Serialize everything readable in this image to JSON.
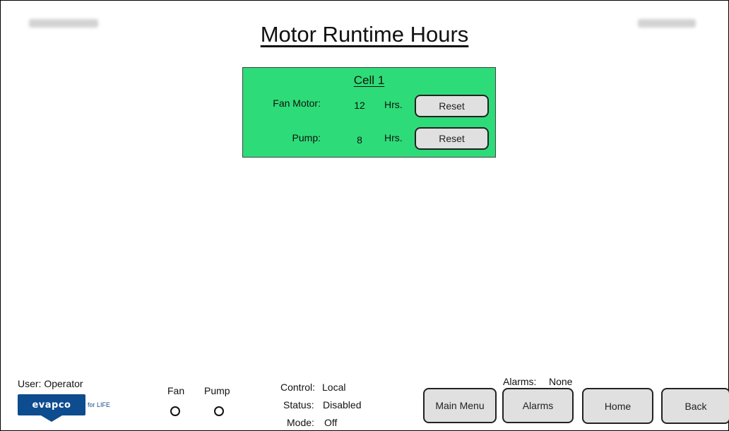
{
  "header": {
    "title": "Motor Runtime Hours"
  },
  "cell": {
    "title": "Cell 1",
    "rows": [
      {
        "label": "Fan Motor:",
        "value": "12",
        "unit": "Hrs.",
        "button": "Reset"
      },
      {
        "label": "Pump:",
        "value": "8",
        "unit": "Hrs.",
        "button": "Reset"
      }
    ]
  },
  "footer": {
    "user": "User: Operator",
    "logo": {
      "text": "evapco",
      "tagline": "for LIFE"
    },
    "indicators": {
      "fan_label": "Fan",
      "pump_label": "Pump",
      "fan_symbol": "O",
      "pump_symbol": "O"
    },
    "control_label": "Control:",
    "control_value": "Local",
    "status_label": "Status:",
    "status_value": "Disabled",
    "mode_label": "Mode:",
    "mode_value": "Off",
    "alarms_label": "Alarms:",
    "alarms_value": "None",
    "buttons": {
      "main_menu": "Main Menu",
      "alarms": "Alarms",
      "home": "Home",
      "back": "Back"
    }
  },
  "colors": {
    "panel_green": "#2ddc78",
    "button_gray": "#e0e0e0",
    "logo_blue": "#0d4c8e"
  }
}
